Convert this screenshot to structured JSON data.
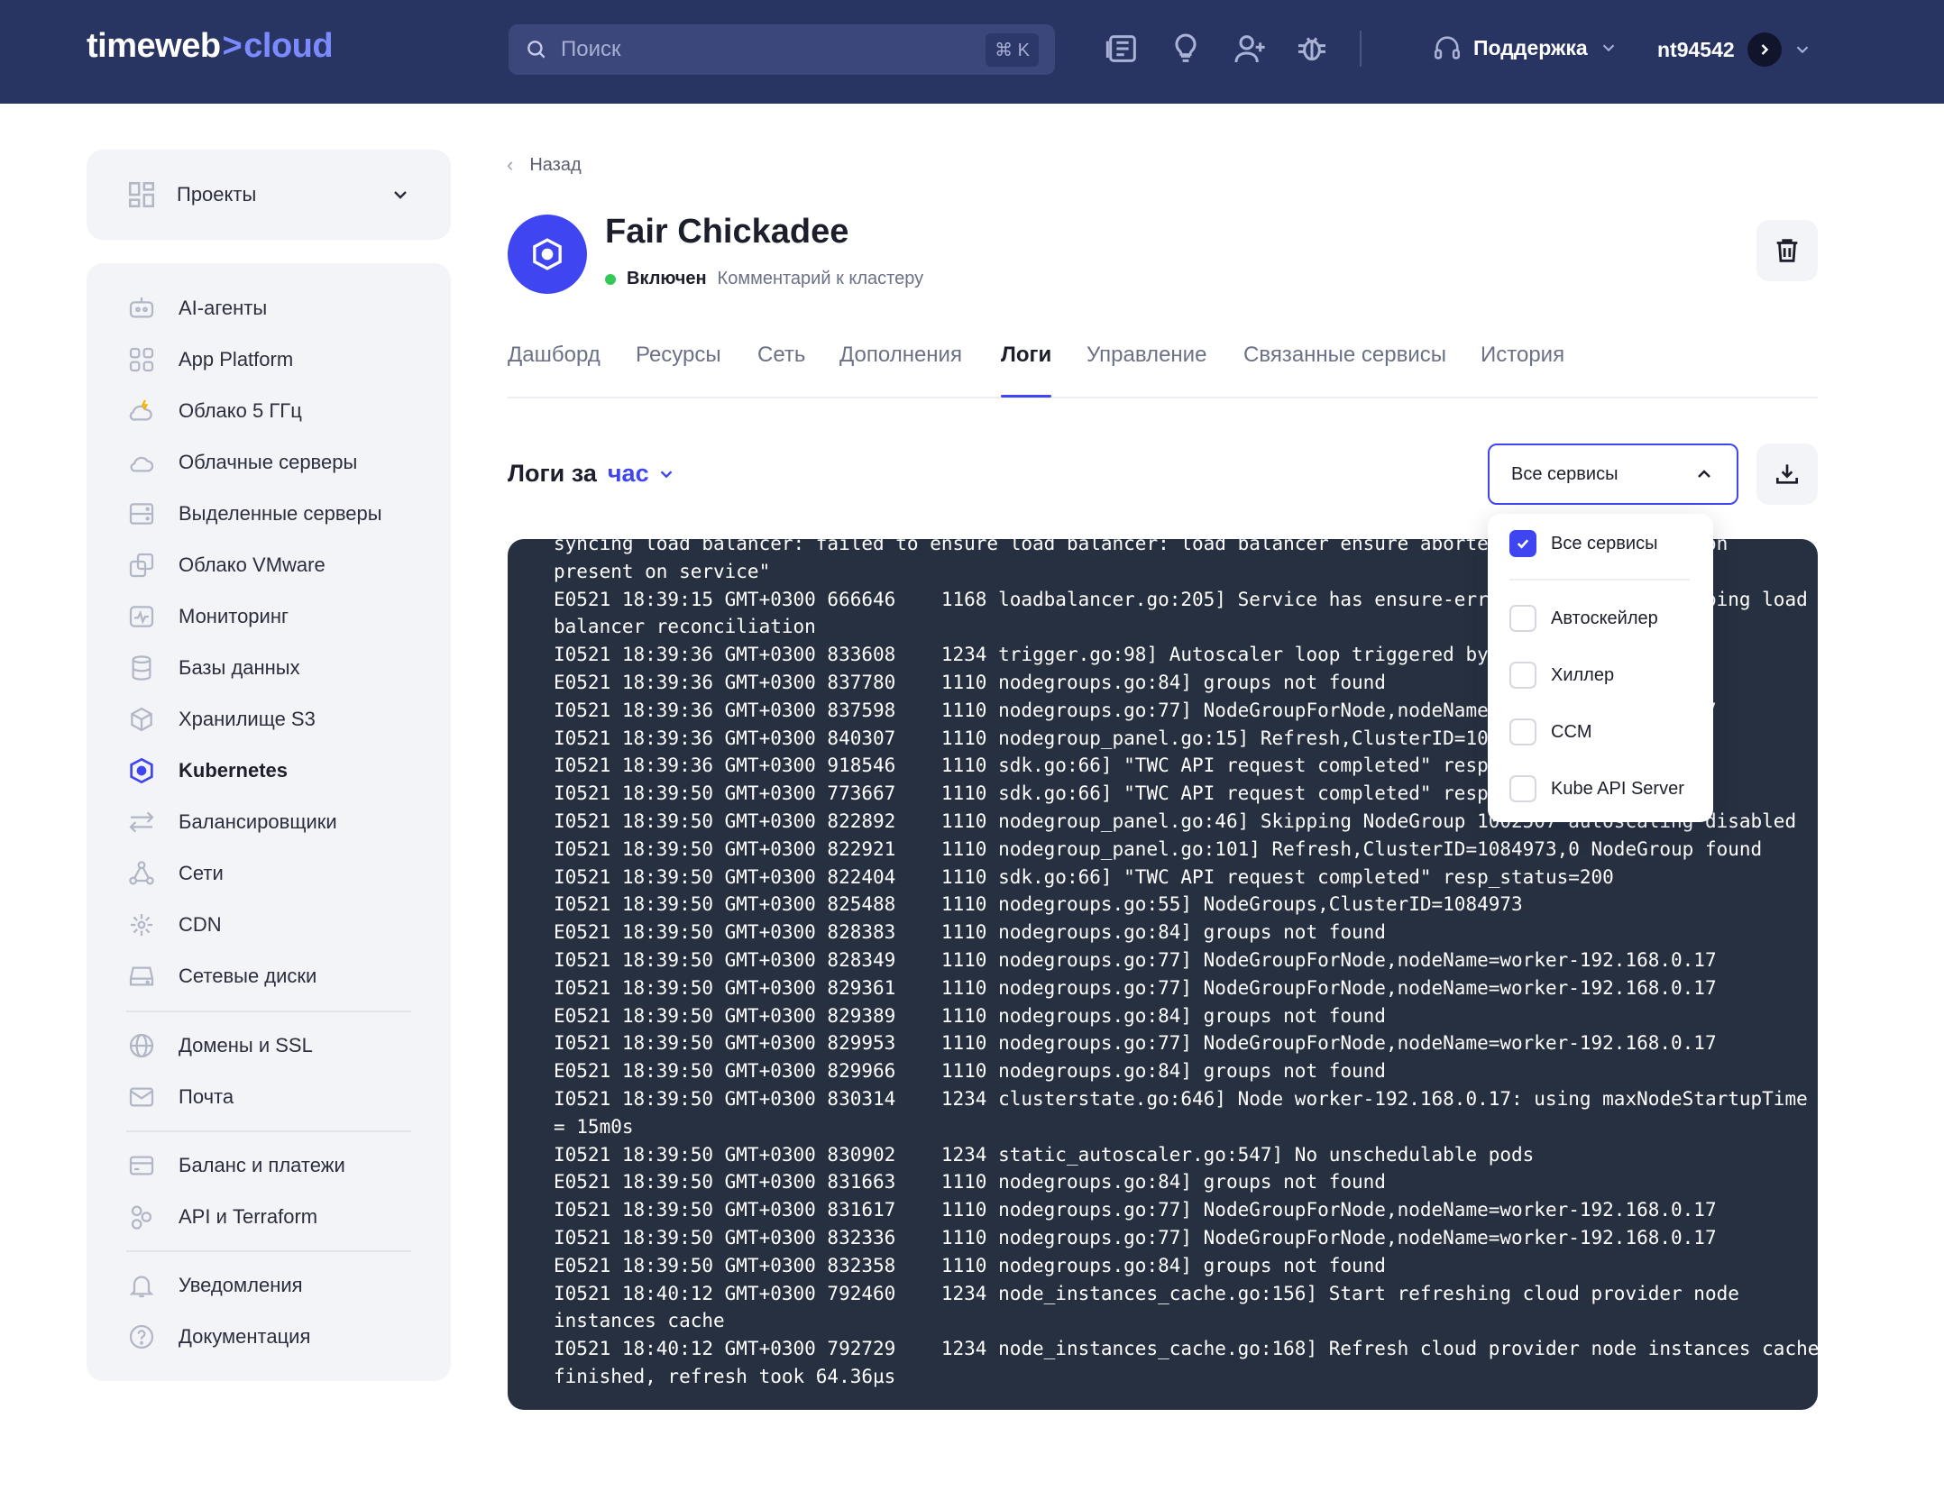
{
  "header": {
    "logo_main": "timeweb",
    "logo_sep": ">",
    "logo_accent": "cloud",
    "search_placeholder": "Поиск",
    "search_shortcut": "⌘ K",
    "support_label": "Поддержка",
    "username": "nt94542"
  },
  "sidebar": {
    "projects_label": "Проекты",
    "items": [
      {
        "label": "AI-агенты",
        "icon": "bot-icon"
      },
      {
        "label": "App Platform",
        "icon": "apps-icon"
      },
      {
        "label": "Облако 5 ГГц",
        "icon": "cloud-bolt-icon"
      },
      {
        "label": "Облачные серверы",
        "icon": "cloud-icon"
      },
      {
        "label": "Выделенные серверы",
        "icon": "server-icon"
      },
      {
        "label": "Облако VMware",
        "icon": "vmware-icon"
      },
      {
        "label": "Мониторинг",
        "icon": "monitoring-icon"
      },
      {
        "label": "Базы данных",
        "icon": "database-icon"
      },
      {
        "label": "Хранилище S3",
        "icon": "storage-cube-icon"
      },
      {
        "label": "Kubernetes",
        "icon": "kubernetes-icon",
        "active": true
      },
      {
        "label": "Балансировщики",
        "icon": "balancer-arrows-icon"
      },
      {
        "label": "Сети",
        "icon": "network-icon"
      },
      {
        "label": "CDN",
        "icon": "cdn-icon"
      },
      {
        "label": "Сетевые диски",
        "icon": "disk-icon"
      },
      {
        "label": "Домены и SSL",
        "icon": "globe-icon"
      },
      {
        "label": "Почта",
        "icon": "mail-icon"
      },
      {
        "label": "Баланс и платежи",
        "icon": "card-icon"
      },
      {
        "label": "API и Terraform",
        "icon": "api-icon"
      },
      {
        "label": "Уведомления",
        "icon": "bell-icon"
      },
      {
        "label": "Документация",
        "icon": "help-icon"
      }
    ]
  },
  "page": {
    "back_label": "Назад",
    "cluster_name": "Fair Chickadee",
    "status_label": "Включен",
    "comment_label": "Комментарий к кластеру",
    "tabs": [
      "Дашборд",
      "Ресурсы",
      "Сеть",
      "Дополнения",
      "Логи",
      "Управление",
      "Связанные сервисы",
      "История"
    ],
    "active_tab": "Логи"
  },
  "logs": {
    "heading": "Логи за",
    "period": "час",
    "service_filter": "Все сервисы",
    "dropdown_options": [
      {
        "label": "Все сервисы",
        "checked": true
      },
      {
        "label": "Автоскейлер",
        "checked": false
      },
      {
        "label": "Хиллер",
        "checked": false
      },
      {
        "label": "CCM",
        "checked": false
      },
      {
        "label": "Kube API Server",
        "checked": false
      }
    ],
    "lines": [
      "syncing load balancer: failed to ensure load balancer: load balancer ensure aborted: service annotation",
      "present on service\"",
      "E0521 18:39:15 GMT+0300 666646    1168 loadbalancer.go:205] Service has ensure-error annotation, skipping load",
      "balancer reconciliation",
      "I0521 18:39:36 GMT+0300 833608    1234 trigger.go:98] Autoscaler loop triggered by a timer",
      "E0521 18:39:36 GMT+0300 837780    1110 nodegroups.go:84] groups not found",
      "I0521 18:39:36 GMT+0300 837598    1110 nodegroups.go:77] NodeGroupForNode,nodeName=worker-192.168.0.17",
      "I0521 18:39:36 GMT+0300 840307    1110 nodegroup_panel.go:15] Refresh,ClusterID=1084973",
      "I0521 18:39:36 GMT+0300 918546    1110 sdk.go:66] \"TWC API request completed\" resp_status=200",
      "I0521 18:39:50 GMT+0300 773667    1110 sdk.go:66] \"TWC API request completed\" resp_status=200",
      "I0521 18:39:50 GMT+0300 822892    1110 nodegroup_panel.go:46] Skipping NodeGroup 1002507 autoscaling disabled",
      "I0521 18:39:50 GMT+0300 822921    1110 nodegroup_panel.go:101] Refresh,ClusterID=1084973,0 NodeGroup found",
      "I0521 18:39:50 GMT+0300 822404    1110 sdk.go:66] \"TWC API request completed\" resp_status=200",
      "I0521 18:39:50 GMT+0300 825488    1110 nodegroups.go:55] NodeGroups,ClusterID=1084973",
      "E0521 18:39:50 GMT+0300 828383    1110 nodegroups.go:84] groups not found",
      "I0521 18:39:50 GMT+0300 828349    1110 nodegroups.go:77] NodeGroupForNode,nodeName=worker-192.168.0.17",
      "I0521 18:39:50 GMT+0300 829361    1110 nodegroups.go:77] NodeGroupForNode,nodeName=worker-192.168.0.17",
      "E0521 18:39:50 GMT+0300 829389    1110 nodegroups.go:84] groups not found",
      "I0521 18:39:50 GMT+0300 829953    1110 nodegroups.go:77] NodeGroupForNode,nodeName=worker-192.168.0.17",
      "E0521 18:39:50 GMT+0300 829966    1110 nodegroups.go:84] groups not found",
      "I0521 18:39:50 GMT+0300 830314    1234 clusterstate.go:646] Node worker-192.168.0.17: using maxNodeStartupTime",
      "= 15m0s",
      "I0521 18:39:50 GMT+0300 830902    1234 static_autoscaler.go:547] No unschedulable pods",
      "E0521 18:39:50 GMT+0300 831663    1110 nodegroups.go:84] groups not found",
      "I0521 18:39:50 GMT+0300 831617    1110 nodegroups.go:77] NodeGroupForNode,nodeName=worker-192.168.0.17",
      "I0521 18:39:50 GMT+0300 832336    1110 nodegroups.go:77] NodeGroupForNode,nodeName=worker-192.168.0.17",
      "E0521 18:39:50 GMT+0300 832358    1110 nodegroups.go:84] groups not found",
      "I0521 18:40:12 GMT+0300 792460    1234 node_instances_cache.go:156] Start refreshing cloud provider node",
      "instances cache",
      "I0521 18:40:12 GMT+0300 792729    1234 node_instances_cache.go:168] Refresh cloud provider node instances cache",
      "finished, refresh took 64.36µs"
    ]
  },
  "colors": {
    "header_bg": "#283462",
    "accent": "#3f45f0",
    "console_bg": "#263040",
    "status_ok": "#34c759"
  }
}
